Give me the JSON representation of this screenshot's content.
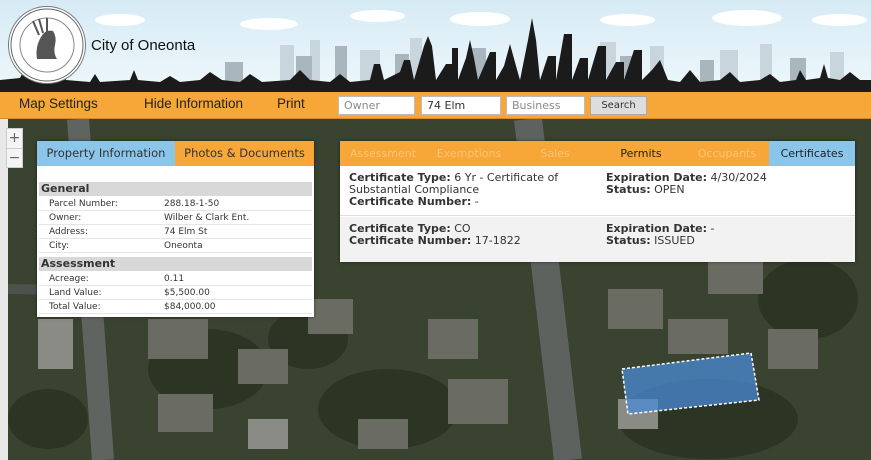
{
  "header": {
    "city_name": "City of Oneonta"
  },
  "toolbar": {
    "menu": [
      "Map Settings",
      "Hide Information",
      "Print"
    ],
    "owner_placeholder": "Owner",
    "address_value": "74 Elm",
    "business_placeholder": "Business",
    "search_label": "Search"
  },
  "zoom": {
    "in": "+",
    "out": "−"
  },
  "left_panel": {
    "tabs": [
      "Property Information",
      "Photos & Documents"
    ],
    "general": {
      "title": "General",
      "rows": [
        {
          "label": "Parcel Number:",
          "value": "288.18-1-50"
        },
        {
          "label": "Owner:",
          "value": "Wilber & Clark Ent."
        },
        {
          "label": "Address:",
          "value": "74 Elm St"
        },
        {
          "label": "City:",
          "value": "Oneonta"
        }
      ]
    },
    "assessment": {
      "title": "Assessment",
      "rows": [
        {
          "label": "Acreage:",
          "value": "0.11"
        },
        {
          "label": "Land Value:",
          "value": "$5,500.00"
        },
        {
          "label": "Total Value:",
          "value": "$84,000.00"
        }
      ]
    }
  },
  "right_panel": {
    "tabs": [
      "Assessment",
      "Exemptions",
      "Sales",
      "Permits",
      "Occupants",
      "Certificates"
    ],
    "active_tab": "Certificates",
    "certificates": [
      {
        "type_label": "Certificate Type:",
        "type": "6 Yr - Certificate of",
        "type_cont": "Substantial Compliance",
        "number_label": "Certificate Number:",
        "number": "-",
        "exp_label": "Expiration Date:",
        "expiration": "4/30/2024",
        "status_label": "Status:",
        "status": "OPEN"
      },
      {
        "type_label": "Certificate Type:",
        "type": "CO",
        "type_cont": "",
        "number_label": "Certificate Number:",
        "number": "17-1822",
        "exp_label": "Expiration Date:",
        "expiration": "-",
        "status_label": "Status:",
        "status": "ISSUED"
      }
    ]
  },
  "colors": {
    "toolbar": "#f7a638",
    "tab_blue": "#8bc6ea",
    "selection": "#4a8ad6"
  }
}
